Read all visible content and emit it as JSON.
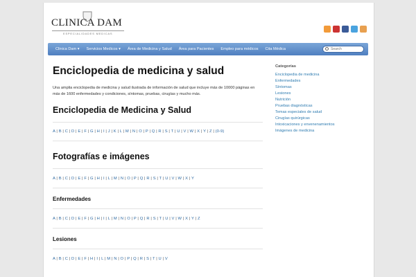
{
  "site": {
    "logo_text": "CLINICA DAM",
    "logo_sub": "ESPECIALIDADES MEDICAS"
  },
  "social": [
    {
      "icon": "rss-feed-icon",
      "color": "#f29b3a"
    },
    {
      "icon": "youtube-icon",
      "color": "#cc3333"
    },
    {
      "icon": "facebook-icon",
      "color": "#3b5b98"
    },
    {
      "icon": "twitter-icon",
      "color": "#4aa3df"
    },
    {
      "icon": "blog-feed-icon",
      "color": "#e8a050"
    }
  ],
  "nav": {
    "items": [
      "Clinica Dam ▾",
      "Servicios Medicos ▾",
      "Área de Medicina y Salud",
      "Área para Pacientes",
      "Empleo para médicos",
      "Cita Médica"
    ],
    "search_placeholder": "Search"
  },
  "main": {
    "title": "Enciclopedia de medicina y salud",
    "intro": "Una amplia enciclopedia de medicina y salud ilustrada de información de salud que incluye más de 10000 páginas en más de 1600 enfermedades y condiciones, síntomas, pruebas, cirugías y mucho más.",
    "section1": "Enciclopedia de Medicina y Salud",
    "section2": "Fotografías e imágenes",
    "sub1": "Enfermedades",
    "sub2": "Lesiones",
    "extra": "(0-9)"
  },
  "alphabets": {
    "a1": [
      "A",
      "B",
      "C",
      "D",
      "E",
      "F",
      "G",
      "H",
      "I",
      "J",
      "K",
      "L",
      "M",
      "N",
      "O",
      "P",
      "Q",
      "R",
      "S",
      "T",
      "U",
      "V",
      "W",
      "X",
      "Y",
      "Z"
    ],
    "a2": [
      "A",
      "B",
      "C",
      "D",
      "E",
      "F",
      "G",
      "H",
      "I",
      "L",
      "M",
      "N",
      "O",
      "P",
      "Q",
      "R",
      "S",
      "T",
      "U",
      "V",
      "W",
      "X",
      "Y"
    ],
    "a3": [
      "A",
      "B",
      "C",
      "D",
      "E",
      "F",
      "G",
      "H",
      "I",
      "L",
      "M",
      "N",
      "O",
      "P",
      "Q",
      "R",
      "S",
      "T",
      "U",
      "V",
      "W",
      "X",
      "Y",
      "Z"
    ],
    "a4": [
      "A",
      "B",
      "C",
      "D",
      "E",
      "F",
      "H",
      "I",
      "L",
      "M",
      "N",
      "O",
      "P",
      "Q",
      "R",
      "S",
      "T",
      "U",
      "V"
    ]
  },
  "sidebar": {
    "title": "Categorías",
    "items": [
      "Enciclopedia de medicina",
      "Enfermedades",
      "Síntomas",
      "Lesiones",
      "Nutrición",
      "Pruebas diagnósticas",
      "Temas especiales de salud",
      "Cirugías quirúrgicas",
      "Intoxicaciones y envenenamientos",
      "Imágenes de medicina"
    ]
  }
}
